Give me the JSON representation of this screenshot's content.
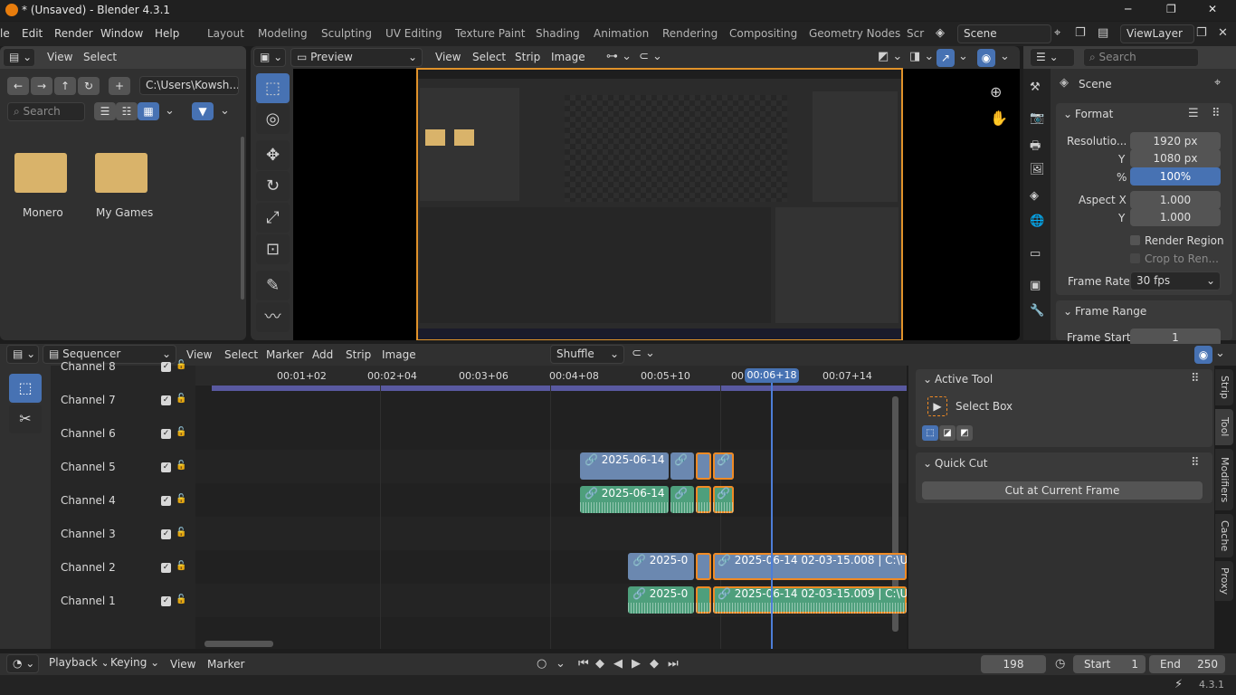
{
  "window": {
    "title": "* (Unsaved) - Blender 4.3.1",
    "min": "─",
    "max": "❐",
    "close": "✕"
  },
  "menu": {
    "file_partial": "le",
    "items": [
      "Edit",
      "Render",
      "Window",
      "Help"
    ]
  },
  "workspaces": [
    "Layout",
    "Modeling",
    "Sculpting",
    "UV Editing",
    "Texture Paint",
    "Shading",
    "Animation",
    "Rendering",
    "Compositing",
    "Geometry Nodes",
    "Scr"
  ],
  "scene": {
    "label": "Scene",
    "viewlayer": "ViewLayer"
  },
  "filebrowser": {
    "menus": [
      "View",
      "Select"
    ],
    "path": "C:\\Users\\Kowsh...",
    "search_placeholder": "Search",
    "folders": [
      "Monero",
      "My Games"
    ]
  },
  "preview": {
    "mode": "Preview",
    "menus": [
      "View",
      "Select",
      "Strip",
      "Image"
    ]
  },
  "properties": {
    "search_placeholder": "Search",
    "scene_name": "Scene",
    "format_title": "Format",
    "res_label": "Resolutio...",
    "res_x": "1920 px",
    "y_label": "Y",
    "res_y": "1080 px",
    "pct_label": "%",
    "pct": "100%",
    "aspect_x_label": "Aspect X",
    "aspect_x": "1.000",
    "aspect_y_label": "Y",
    "aspect_y": "1.000",
    "render_region": "Render Region",
    "crop": "Crop to Ren...",
    "frame_rate_label": "Frame Rate",
    "frame_rate": "30 fps",
    "frame_range_title": "Frame Range",
    "frame_start_label": "Frame Start",
    "frame_start": "1"
  },
  "sequencer": {
    "editor": "Sequencer",
    "menus": [
      "View",
      "Select",
      "Marker",
      "Add",
      "Strip",
      "Image"
    ],
    "overlap": "Shuffle",
    "ticks": [
      "00:01+02",
      "00:02+04",
      "00:03+06",
      "00:04+08",
      "00:05+10",
      "00:0",
      "00:07+14"
    ],
    "current_time": "00:06+18",
    "channels": [
      "Channel 8",
      "Channel 7",
      "Channel 6",
      "Channel 5",
      "Channel 4",
      "Channel 3",
      "Channel 2",
      "Channel 1"
    ],
    "strips": {
      "c5": "2025-06-14",
      "c4": "2025-06-14",
      "c2a": "2025-0",
      "c2b": "2025-06-14 02-03-15.008 | C:\\U",
      "c1a": "2025-0",
      "c1b": "2025-06-14 02-03-15.009 | C:\\U"
    }
  },
  "sidebar": {
    "active_tool": "Active Tool",
    "select_box": "Select Box",
    "quick_cut": "Quick Cut",
    "cut_btn": "Cut at Current Frame",
    "tabs": [
      "Strip",
      "Tool",
      "Modifiers",
      "Cache",
      "Proxy"
    ]
  },
  "timeline": {
    "menus": [
      "Playback",
      "Keying",
      "View",
      "Marker"
    ],
    "frame": "198",
    "start_label": "Start",
    "start": "1",
    "end_label": "End",
    "end": "250"
  },
  "status": {
    "version": "4.3.1"
  }
}
